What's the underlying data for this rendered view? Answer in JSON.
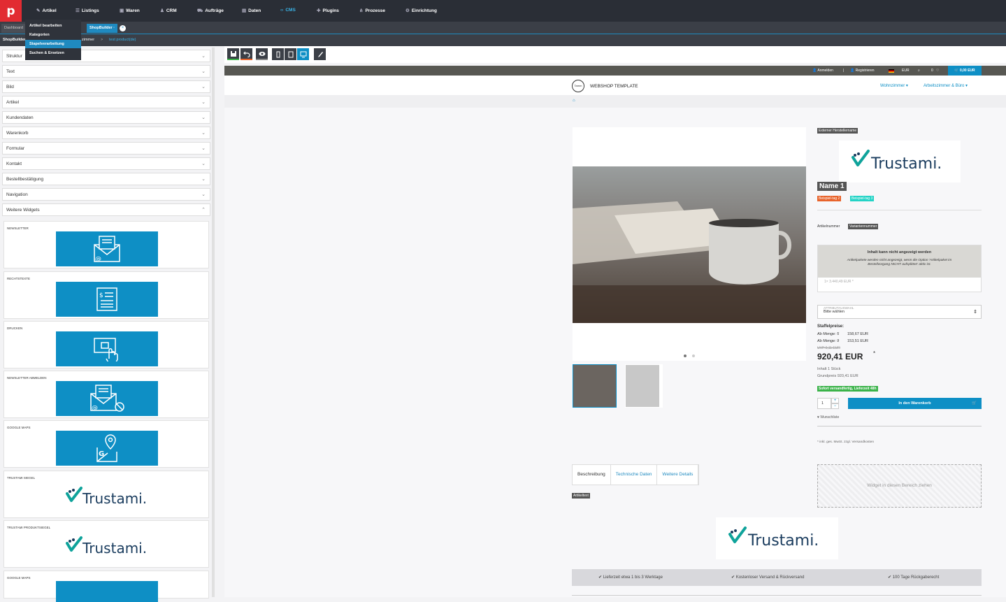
{
  "app": {
    "logo": "p"
  },
  "nav": {
    "items": [
      {
        "label": "Artikel",
        "icon": "tag-icon"
      },
      {
        "label": "Listings",
        "icon": "list-icon"
      },
      {
        "label": "Waren",
        "icon": "truck-icon"
      },
      {
        "label": "CRM",
        "icon": "users-icon"
      },
      {
        "label": "Aufträge",
        "icon": "cart-icon"
      },
      {
        "label": "Daten",
        "icon": "database-icon"
      },
      {
        "label": "CMS",
        "icon": "code-icon"
      },
      {
        "label": "Plugins",
        "icon": "puzzle-icon"
      },
      {
        "label": "Prozesse",
        "icon": "sitemap-icon"
      },
      {
        "label": "Einrichtung",
        "icon": "gear-icon"
      }
    ]
  },
  "tabs": {
    "dashboard": "Dashboard",
    "shopbuilder": "ShopBuilder ·",
    "close": "×"
  },
  "breadcrumb": {
    "root": "ShopBuilder",
    "mid": "zimmer",
    "sep": ">",
    "leaf": "test product(de)"
  },
  "dropdown": {
    "items": [
      "Artikel bearbeiten",
      "Kategorien",
      "Stapelverarbeitung",
      "Suchen & Ersetzen"
    ]
  },
  "sidebar": {
    "accordion": [
      "Struktur",
      "Text",
      "Bild",
      "Artikel",
      "Kundendaten",
      "Warenkorb",
      "Formular",
      "Kontakt",
      "Bestellbestätigung",
      "Navigation",
      "Weitere Widgets"
    ],
    "widgets": [
      "NEWSLETTER",
      "RECHTSTEXTE",
      "DRUCKEN",
      "NEWSLETTER ABMELDEN",
      "GOOGLE MAPS",
      "TRUSTAMI SIEGEL",
      "TRUSTAMI PRODUKTSIEGEL",
      "GOOGLE MAPS"
    ]
  },
  "brand": {
    "trustami": "Trustami."
  },
  "shop": {
    "top": {
      "login": "Anmelden",
      "sep": "|",
      "register": "Registrieren",
      "currency": "EUR",
      "wish_count": "0",
      "cart": "0,00 EUR"
    },
    "header": {
      "logo_small": "Tamm",
      "title": "WEBSHOP TEMPLATE",
      "nav1": "Wohnzimmer ▾",
      "nav2": "Arbeitszimmer & Büro ▾"
    },
    "product": {
      "manufacturer": "Externer Herstellername",
      "name": "Name 1",
      "tag1": "Beispiel-tag 2",
      "tag2": "Beispiel-tag 3",
      "artnr_label": "Artikelnummer",
      "artnr_value": "Variantennummer",
      "warn_title": "Inhalt kann nicht angezeigt werden",
      "warn_text1": "Artikelpakete werden nicht angezeigt, wenn die Option 'Artikelpaket im",
      "warn_text2": "Bestellvorgang NICHT aufsplitten' aktiv ist.",
      "bundle_price": "1× 3.440,49 EUR *",
      "attr_label": "ATTRIBUTAUSWAHL",
      "attr_value": "Bitte wählen",
      "graduated_title": "Staffelpreise:",
      "grad1_label": "Ab Menge: 5",
      "grad1_value": "158,67 EUR",
      "grad2_label": "Ab Menge: 9",
      "grad2_value": "153,51 EUR",
      "old_price": "UVP 0,11 EUR",
      "price": "920,41 EUR",
      "price_star": "*",
      "content": "Inhalt 1 Stück",
      "base_price": "Grundpreis 920,41 EUR",
      "availability": "Sofort versandfertig, Lieferzeit 48h",
      "qty": "1",
      "add_to_cart": "In den Warenkorb",
      "wishlist": "Wunschliste",
      "vat": "* inkl. ges. MwSt. zzgl. Versandkosten",
      "dropzone": "Widget in diesen Bereich ziehen",
      "tabs": [
        "Beschreibung",
        "Technische Daten",
        "Weitere Details"
      ],
      "desc_tag": "Artikeltext"
    },
    "benefits": [
      "Lieferzeit etwa 1 bis 3 Werktage",
      "Kostenloser Versand & Rückversand",
      "100 Tage Rückgaberecht"
    ]
  },
  "colors": {
    "accent": "#0e8fc5",
    "brand_red": "#e22b32",
    "topbar": "#2a2e36",
    "trust_green": "#0fa39b",
    "trust_navy": "#1a3c5e"
  }
}
